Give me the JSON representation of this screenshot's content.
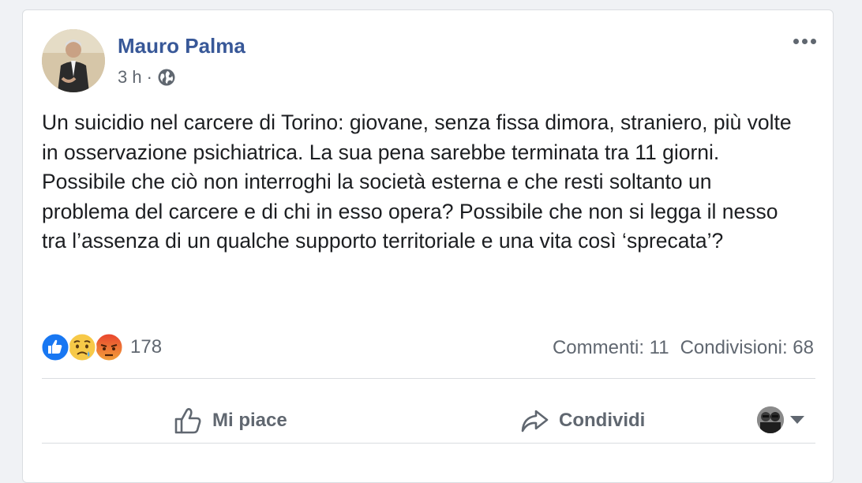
{
  "post": {
    "author": "Mauro Palma",
    "time": "3 h",
    "separator": "·",
    "privacy_icon": "globe-icon",
    "more_icon": "more-options-icon",
    "paragraphs": [
      "Un suicidio nel carcere di Torino: giovane, senza fissa dimora, straniero, più volte in osservazione psichiatrica. La sua pena sarebbe terminata tra 11 giorni.",
      "Possibile che ciò non interroghi la società esterna e che resti soltanto un problema del carcere e di chi in esso opera? Possibile che non si legga il nesso tra l’assenza di un qualche supporto territoriale e una vita così ‘sprecata’?"
    ]
  },
  "reactions": {
    "icons": [
      "like-reaction-icon",
      "sad-reaction-icon",
      "angry-reaction-icon"
    ],
    "count": "178"
  },
  "stats": {
    "comments": "Commenti: 11",
    "shares": "Condivisioni: 68"
  },
  "actions": {
    "like_label": "Mi piace",
    "share_label": "Condividi",
    "like_icon": "thumbs-up-icon",
    "share_icon": "share-arrow-icon",
    "audience_icon": "audience-selector-icon"
  },
  "colors": {
    "author": "#385898",
    "secondary_text": "#606770",
    "body_text": "#1c1e21",
    "like_blue": "#1877f2",
    "angry_red": "#e9432d",
    "sad_yellow": "#f7c948"
  }
}
